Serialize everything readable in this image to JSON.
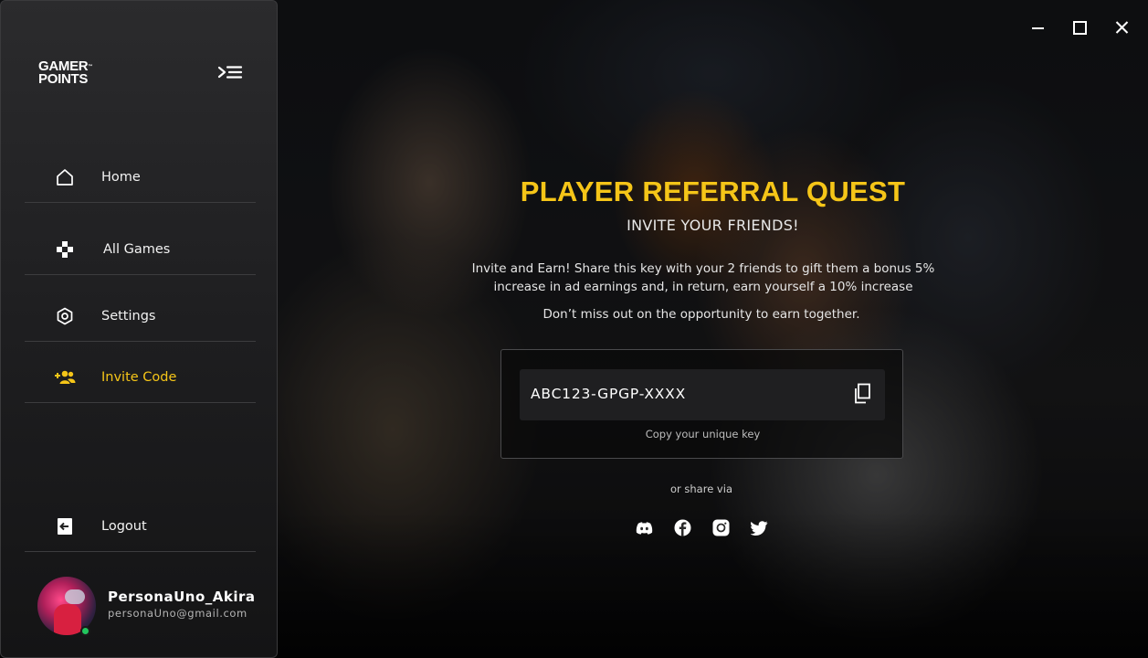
{
  "window": {
    "controls": [
      "minimize",
      "maximize",
      "close"
    ]
  },
  "sidebar": {
    "logo_line1": "GAMER",
    "logo_tm": "™",
    "logo_line2": "POINTS",
    "collapse_icon": "collapse-menu-icon",
    "items": [
      {
        "label": "Home",
        "icon": "home-icon",
        "active": false
      },
      {
        "label": "All Games",
        "icon": "gamepad-icon",
        "active": false
      },
      {
        "label": "Settings",
        "icon": "settings-icon",
        "active": false
      },
      {
        "label": "Invite Code",
        "icon": "add-users-icon",
        "active": true
      }
    ],
    "logout": {
      "label": "Logout",
      "icon": "logout-icon"
    },
    "user": {
      "name": "PersonaUno_Akira",
      "email": "personaUno@gmail.com",
      "status": "online"
    }
  },
  "main": {
    "title": "PLAYER REFERRAL QUEST",
    "subtitle": "INVITE YOUR FRIENDS!",
    "description": "Invite and Earn! Share this key with your 2 friends to gift them a bonus 5% increase in ad earnings and, in return, earn yourself a 10% increase",
    "description2": "Don’t miss out on the opportunity to earn together.",
    "key": {
      "value": "ABC123-GPGP-XXXX",
      "caption": "Copy your unique key",
      "copy_icon": "copy-icon"
    },
    "share_label": "or share via",
    "socials": [
      "discord-icon",
      "facebook-icon",
      "instagram-icon",
      "twitter-icon"
    ]
  },
  "colors": {
    "accent": "#f5c518",
    "sidebar_bg": "#232325",
    "online": "#22c55e"
  }
}
